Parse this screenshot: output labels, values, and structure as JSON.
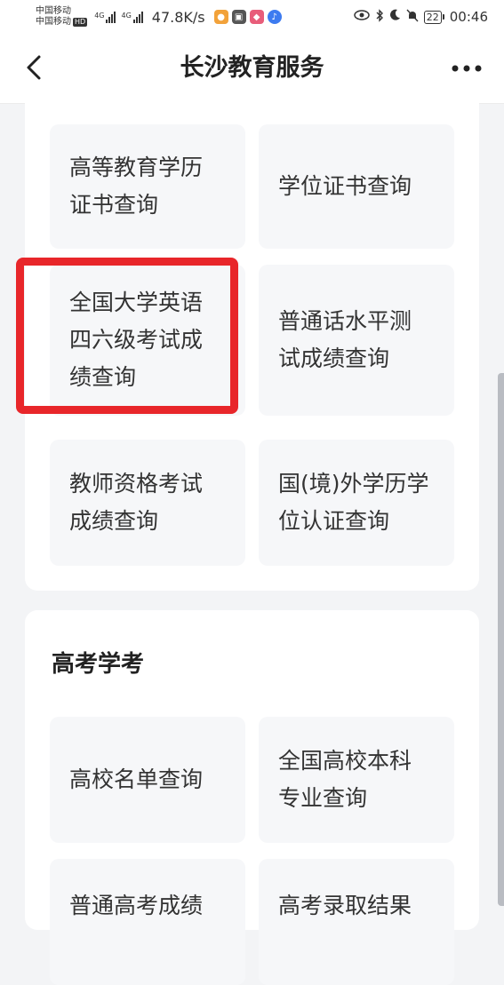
{
  "status_bar": {
    "carrier1": "中国移动",
    "carrier2": "中国移动",
    "hd": "HD",
    "signal_tag": "4G",
    "net_speed": "47.8K/s",
    "battery": "22",
    "time": "00:46"
  },
  "header": {
    "title": "长沙教育服务"
  },
  "section1": {
    "tiles": [
      {
        "label": "高等教育学历证书查询"
      },
      {
        "label": "学位证书查询"
      },
      {
        "label": "全国大学英语四六级考试成绩查询"
      },
      {
        "label": "普通话水平测试成绩查询"
      },
      {
        "label": "教师资格考试成绩查询"
      },
      {
        "label": "国(境)外学历学位认证查询"
      }
    ]
  },
  "section2": {
    "title": "高考学考",
    "tiles": [
      {
        "label": "高校名单查询"
      },
      {
        "label": "全国高校本科专业查询"
      },
      {
        "label": "普通高考成绩"
      },
      {
        "label": "高考录取结果"
      }
    ]
  },
  "colors": {
    "highlight": "#e8262a",
    "tile_bg": "#f6f7f9",
    "page_bg": "#f3f4f6"
  }
}
